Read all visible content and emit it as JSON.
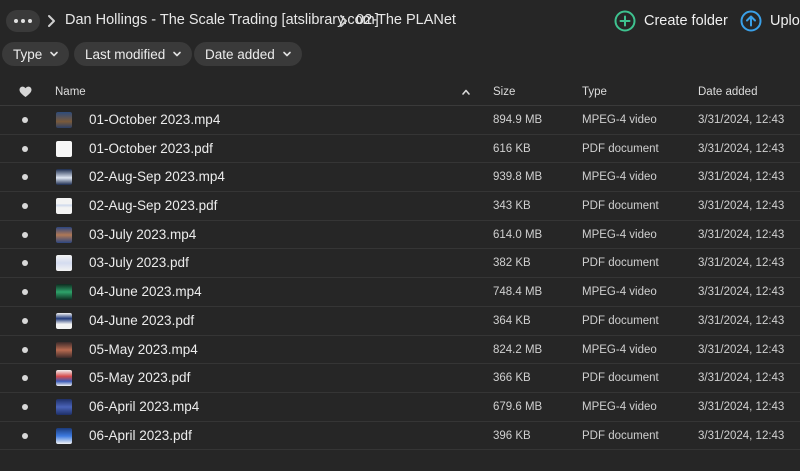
{
  "breadcrumb": {
    "items": [
      "Dan Hollings - The Scale Trading [atslibrary.com]",
      "02-The PLANet"
    ]
  },
  "actions": {
    "create_folder": "Create folder",
    "upload": "Upload"
  },
  "filters": [
    "Type",
    "Last modified",
    "Date added"
  ],
  "columns": {
    "name": "Name",
    "size": "Size",
    "type": "Type",
    "date_added": "Date added"
  },
  "files": [
    {
      "name": "01-October 2023.mp4",
      "size": "894.9 MB",
      "type": "MPEG-4 video",
      "date": "3/31/2024, 12:43",
      "thumb": "v1"
    },
    {
      "name": "01-October 2023.pdf",
      "size": "616 KB",
      "type": "PDF document",
      "date": "3/31/2024, 12:43",
      "thumb": "p1"
    },
    {
      "name": "02-Aug-Sep 2023.mp4",
      "size": "939.8 MB",
      "type": "MPEG-4 video",
      "date": "3/31/2024, 12:43",
      "thumb": "v2"
    },
    {
      "name": "02-Aug-Sep 2023.pdf",
      "size": "343 KB",
      "type": "PDF document",
      "date": "3/31/2024, 12:43",
      "thumb": "p2"
    },
    {
      "name": "03-July 2023.mp4",
      "size": "614.0 MB",
      "type": "MPEG-4 video",
      "date": "3/31/2024, 12:43",
      "thumb": "v3"
    },
    {
      "name": "03-July 2023.pdf",
      "size": "382 KB",
      "type": "PDF document",
      "date": "3/31/2024, 12:43",
      "thumb": "p3"
    },
    {
      "name": "04-June 2023.mp4",
      "size": "748.4 MB",
      "type": "MPEG-4 video",
      "date": "3/31/2024, 12:43",
      "thumb": "v4"
    },
    {
      "name": "04-June 2023.pdf",
      "size": "364 KB",
      "type": "PDF document",
      "date": "3/31/2024, 12:43",
      "thumb": "p4"
    },
    {
      "name": "05-May 2023.mp4",
      "size": "824.2 MB",
      "type": "MPEG-4 video",
      "date": "3/31/2024, 12:43",
      "thumb": "v5"
    },
    {
      "name": "05-May 2023.pdf",
      "size": "366 KB",
      "type": "PDF document",
      "date": "3/31/2024, 12:43",
      "thumb": "p5"
    },
    {
      "name": "06-April 2023.mp4",
      "size": "679.6 MB",
      "type": "MPEG-4 video",
      "date": "3/31/2024, 12:43",
      "thumb": "v6"
    },
    {
      "name": "06-April 2023.pdf",
      "size": "396 KB",
      "type": "PDF document",
      "date": "3/31/2024, 12:43",
      "thumb": "p6"
    }
  ],
  "icons": {
    "more": "more-icon",
    "breadcrumb_separator": "chevron-right-icon",
    "create_folder": "plus-circle-icon",
    "upload": "upload-arrow-icon",
    "filter_dropdown": "chevron-down-icon",
    "favorite_column": "heart-icon",
    "sort": "sort-ascending-icon"
  },
  "colors": {
    "background": "#262626",
    "chip": "#3a3a3a",
    "create_folder_accent": "#3ec28f",
    "upload_accent": "#3aa0e8"
  }
}
